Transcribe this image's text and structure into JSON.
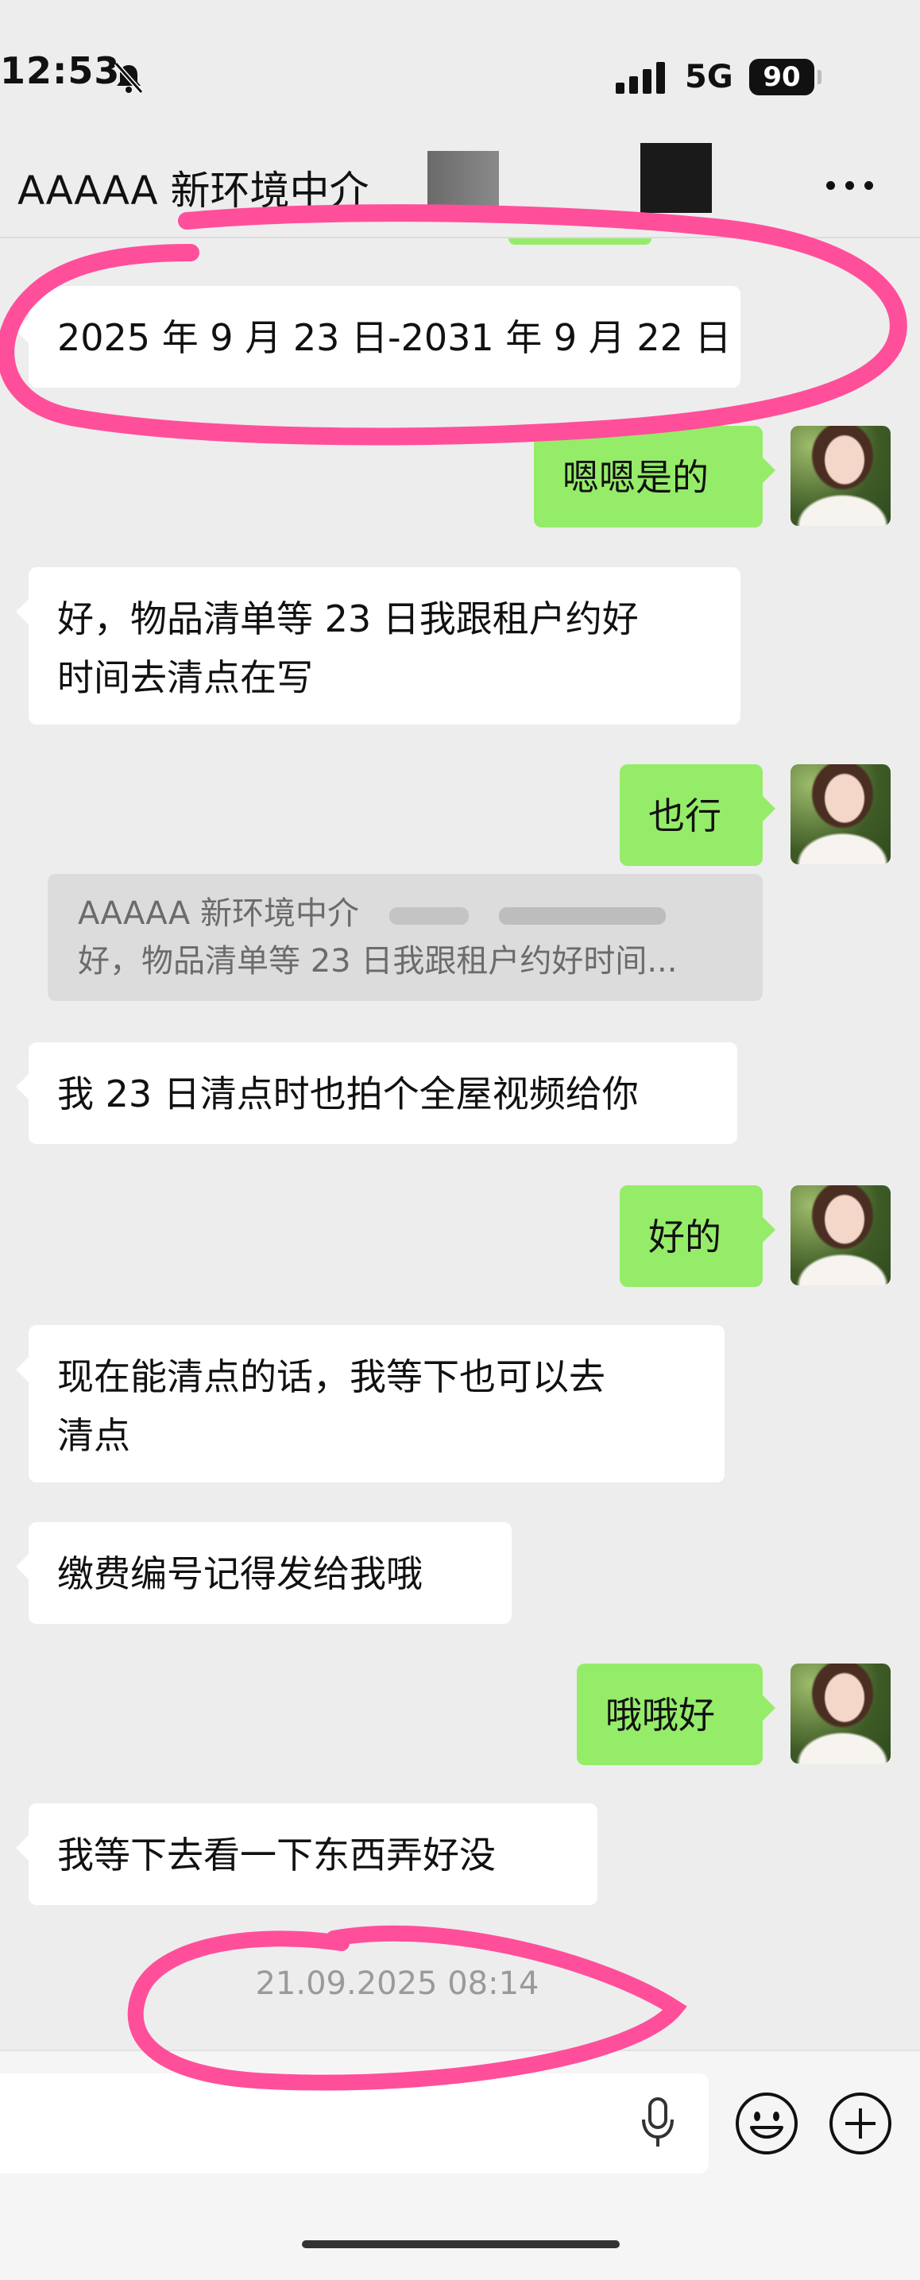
{
  "status_bar": {
    "time": "12:53",
    "network": "5G",
    "battery": "90"
  },
  "header": {
    "title": "AAAAA 新环境中介"
  },
  "messages": [
    {
      "side": "left",
      "lines": [
        "2025 年 9 月 23 日-2031 年 9 月 22 日"
      ]
    },
    {
      "side": "right",
      "lines": [
        "嗯嗯是的"
      ]
    },
    {
      "side": "left",
      "lines": [
        "好，物品清单等 23 日我跟租户约好",
        "时间去清点在写"
      ]
    },
    {
      "side": "right",
      "lines": [
        "也行"
      ]
    },
    {
      "side": "left",
      "lines": [
        "我 23 日清点时也拍个全屋视频给你"
      ]
    },
    {
      "side": "right",
      "lines": [
        "好的"
      ]
    },
    {
      "side": "left",
      "lines": [
        "现在能清点的话，我等下也可以去",
        "清点"
      ]
    },
    {
      "side": "left",
      "lines": [
        "缴费编号记得发给我哦"
      ]
    },
    {
      "side": "right",
      "lines": [
        "哦哦好"
      ]
    },
    {
      "side": "left",
      "lines": [
        "我等下去看一下东西弄好没"
      ]
    }
  ],
  "quote": {
    "sender": "AAAAA 新环境中介",
    "text": "好，物品清单等 23 日我跟租户约好时间..."
  },
  "timestamp": "21.09.2025 08:14",
  "input": {
    "placeholder": ""
  },
  "icons": {
    "bell": "bell-muted-icon",
    "more": "more-icon",
    "mic": "mic-icon",
    "emoji": "emoji-icon",
    "plus": "plus-icon"
  },
  "colors": {
    "background": "#ededed",
    "bubble_left": "#ffffff",
    "bubble_right": "#95ec69",
    "annotation": "#ff4f9a"
  }
}
